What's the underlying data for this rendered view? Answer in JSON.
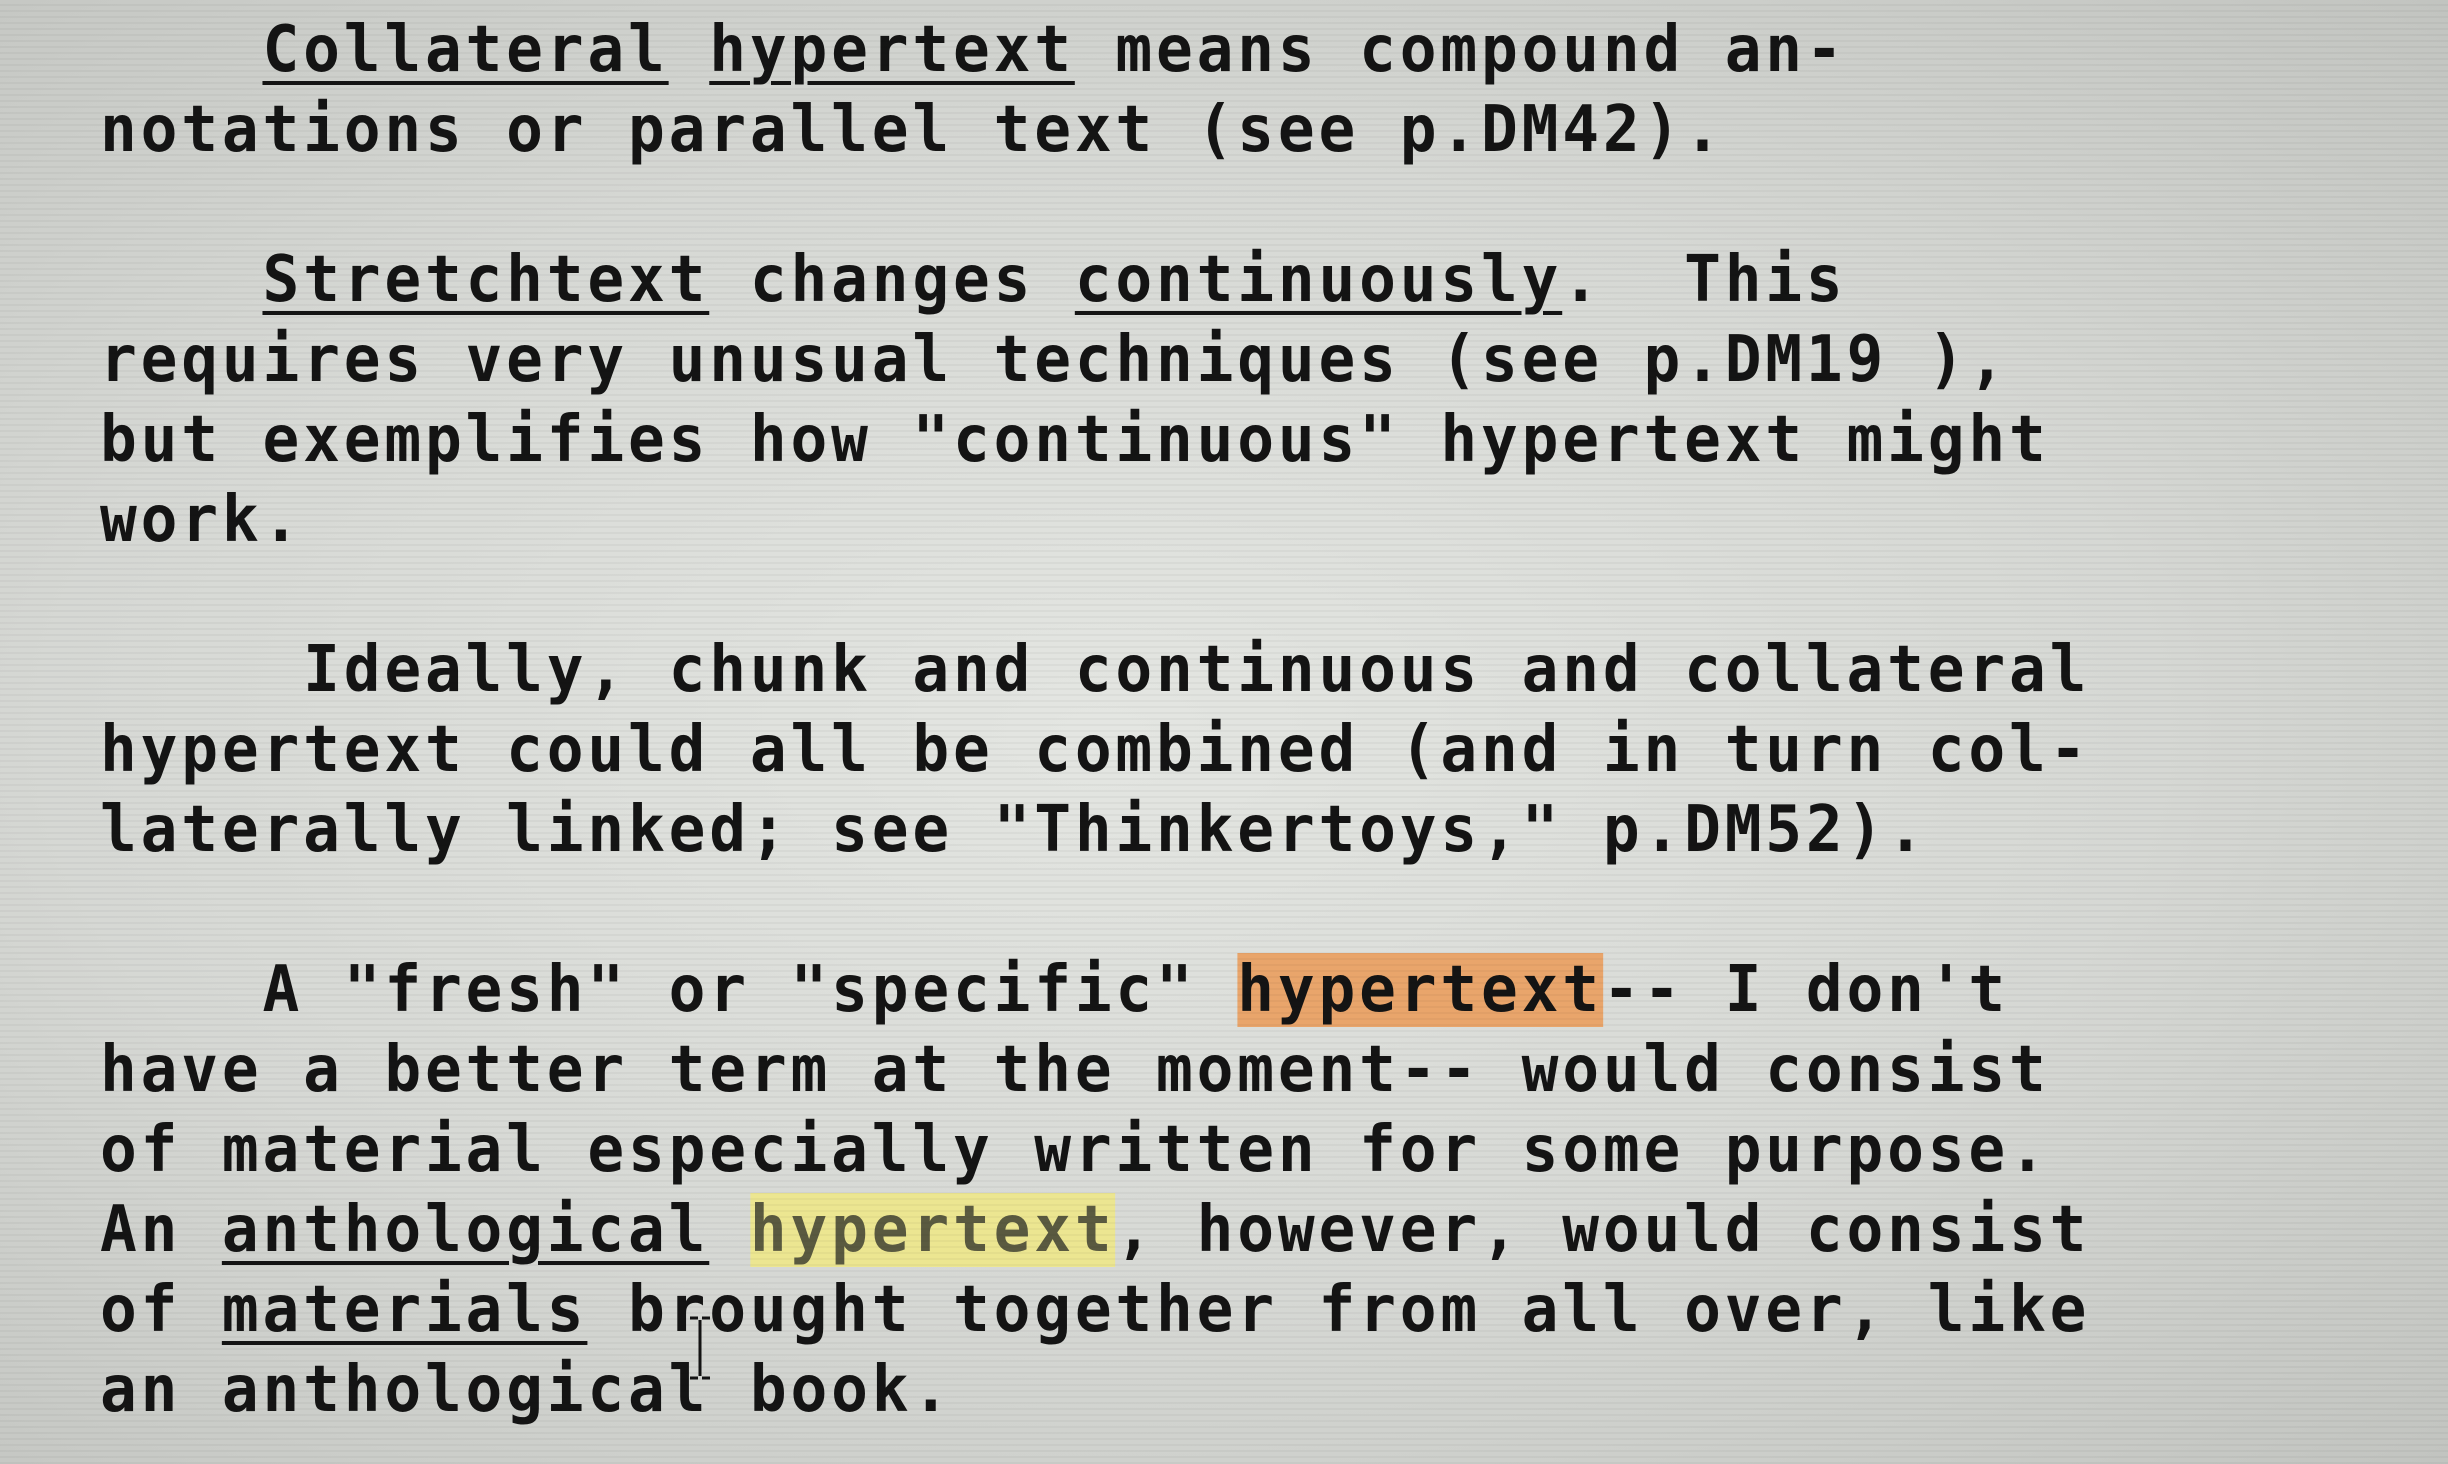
{
  "p1": {
    "l1": {
      "indent": "    ",
      "w1": "Collateral",
      "sp1": " ",
      "w2": "hypertext",
      "rest": " means compound an-"
    },
    "l2": "notations or parallel text (see p.DM42)."
  },
  "p2": {
    "l1": {
      "indent": "    ",
      "w1": "Stretchtext",
      "mid": " changes ",
      "w2": "continuously",
      "rest": ".  This"
    },
    "l2": "requires very unusual techniques (see p.DM19 ),",
    "l3": "but exemplifies how \"continuous\" hypertext might",
    "l4": "work."
  },
  "p3": {
    "l1": "     Ideally, chunk and continuous and collateral",
    "l2": "hypertext could all be combined (and in turn col-",
    "l3": "laterally linked; see \"Thinkertoys,\" p.DM52)."
  },
  "p4": {
    "l1": {
      "pre": "    A \"fresh\" or \"specific\" ",
      "hl": "hypertext",
      "post": "-- I don't"
    },
    "l2": "have a better term at the moment-- would consist",
    "l3": "of material especially written for some purpose.",
    "l4": {
      "pre": "An ",
      "ul": "anthological",
      "sp": " ",
      "hl": "hypertext",
      "post": ", however, would consist"
    },
    "l5": {
      "pre": "of ",
      "ul": "materials",
      "post": " brought together from all over, like"
    },
    "l6": "an anthological book."
  },
  "colors": {
    "background": "#d6d8d4",
    "text": "#141414",
    "highlight_orange": "#e9a56b",
    "highlight_yellow": "#ece691"
  },
  "icons": {
    "cursor": "text-cursor-icon"
  }
}
